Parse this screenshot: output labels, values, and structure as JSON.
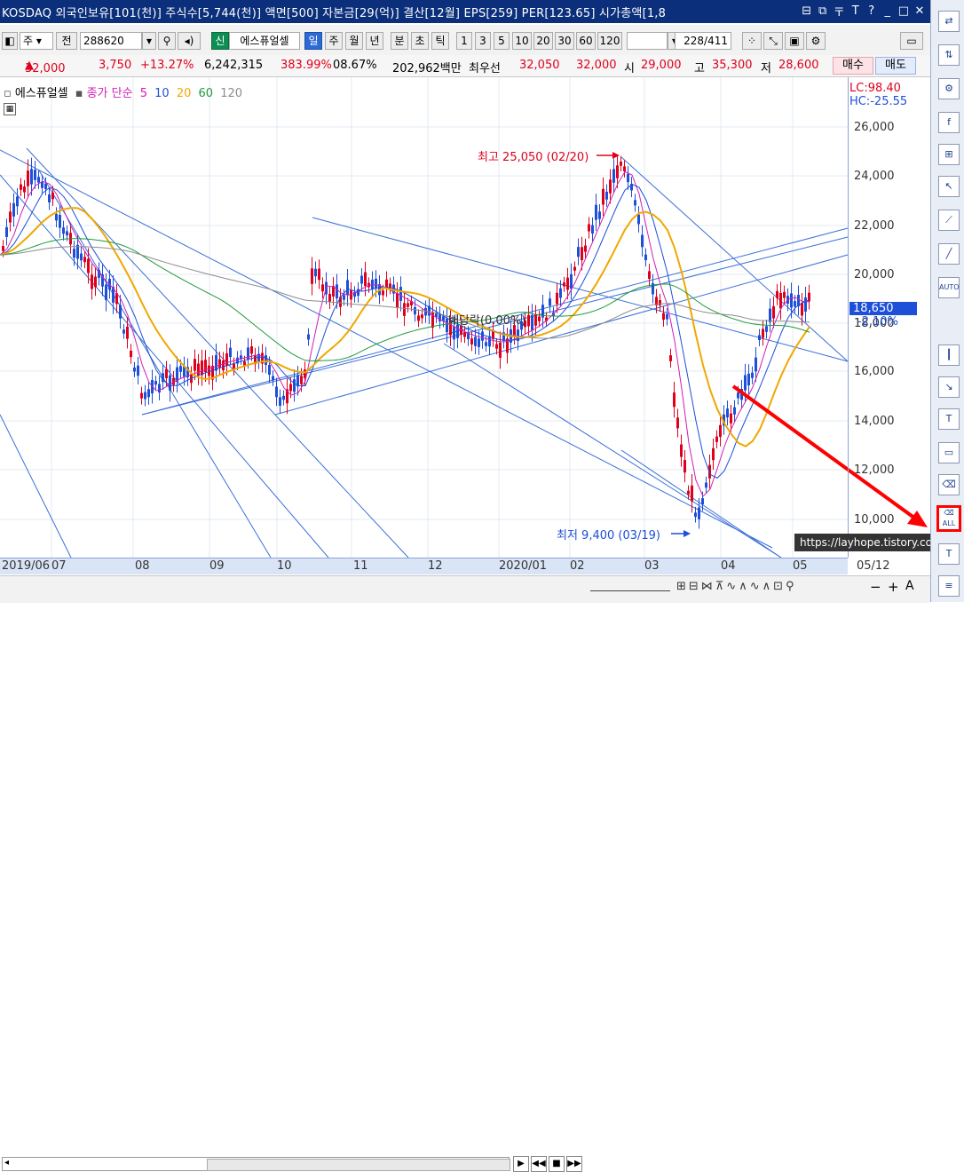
{
  "titlebar": {
    "text": "KOSDAQ 외국인보유[101(천)] 주식수[5,744(천)] 액면[500] 자본금[29(억)] 결산[12월] EPS[259] PER[123.65] 시가총액[1,8",
    "controls": [
      "⊟",
      "⧉",
      "〒",
      "T",
      "?",
      "_",
      "□",
      "✕"
    ]
  },
  "toolbar": {
    "market": "주",
    "prefix": "전",
    "code": "288620",
    "new_badge": "신",
    "stock_name": "에스퓨얼셀",
    "periods": [
      "일",
      "주",
      "월",
      "년",
      "분",
      "초",
      "틱"
    ],
    "active_period": "일",
    "minute_options": [
      "1",
      "3",
      "5",
      "10",
      "20",
      "30",
      "60",
      "120"
    ],
    "count": "228",
    "total": "/411"
  },
  "quote": {
    "price": "32,000",
    "change": "3,750",
    "change_pct": "+13.27%",
    "volume": "6,242,315",
    "vol_ratio": "383.99%",
    "turnover": "08.67%",
    "amount": "202,962백만",
    "best_label": "최우선",
    "best_ask": "32,050",
    "best_bid": "32,000",
    "open_label": "시",
    "open": "29,000",
    "high_label": "고",
    "high": "35,300",
    "low_label": "저",
    "low": "28,600",
    "buy": "매수",
    "sell": "매도"
  },
  "legend": {
    "name": "에스퓨얼셀",
    "ma_label": "종가 단순",
    "ma": [
      {
        "label": "5",
        "color": "#d11fb5"
      },
      {
        "label": "10",
        "color": "#1d4fd8"
      },
      {
        "label": "20",
        "color": "#f0a800"
      },
      {
        "label": "60",
        "color": "#1f9b3a"
      },
      {
        "label": "120",
        "color": "#8c8c8c"
      }
    ]
  },
  "lc": "LC:98.40",
  "hc": "HC:-25.55",
  "current_price": "18,650",
  "current_pct": "-2.10%",
  "yaxis": [
    "26,000",
    "24,000",
    "22,000",
    "20,000",
    "18,000",
    "16,000",
    "14,000",
    "12,000",
    "10,000"
  ],
  "xaxis": [
    "2019/06",
    "07",
    "08",
    "09",
    "10",
    "11",
    "12",
    "2020/01",
    "02",
    "03",
    "04",
    "05",
    "05/12"
  ],
  "annotations": {
    "high": "최고 25,050 (02/20)",
    "low": "최저 9,400 (03/19)",
    "dividend": "배당락(0.00%)"
  },
  "watermark": "https://layhope.tistory.com",
  "sidebar": {
    "selected_label": "ALL",
    "items": [
      "refresh-icon",
      "compare-icon",
      "settings-icon",
      "formula-icon",
      "indicator-icon",
      "cursor-icon",
      "trendline-icon",
      "line-icon",
      "auto-trend-icon",
      "candle-icon",
      "fall-icon",
      "text-icon",
      "box-icon",
      "eraser-icon",
      "eraser-all-icon",
      "text-tool-icon",
      "list-icon"
    ]
  }
}
